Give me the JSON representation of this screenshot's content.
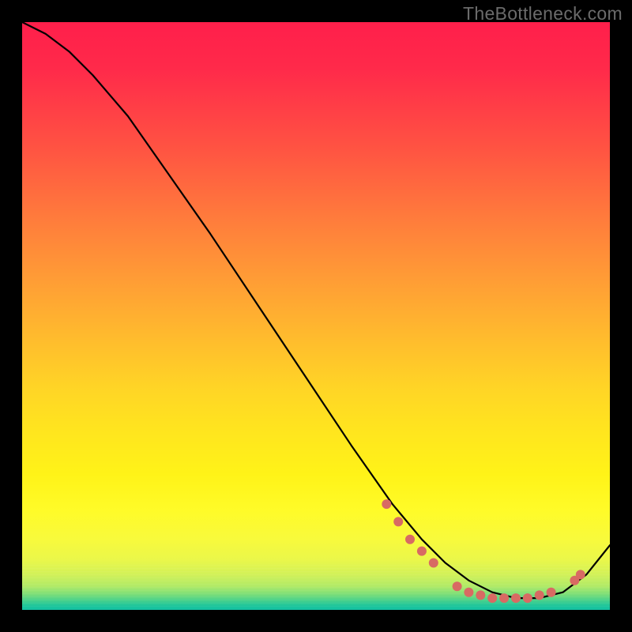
{
  "watermark": "TheBottleneck.com",
  "chart_data": {
    "type": "line",
    "title": "",
    "xlabel": "",
    "ylabel": "",
    "xlim": [
      0,
      100
    ],
    "ylim": [
      0,
      100
    ],
    "series": [
      {
        "name": "curve",
        "x": [
          0,
          4,
          8,
          12,
          18,
          25,
          32,
          40,
          48,
          56,
          63,
          68,
          72,
          76,
          80,
          84,
          88,
          92,
          96,
          100
        ],
        "y": [
          100,
          98,
          95,
          91,
          84,
          74,
          64,
          52,
          40,
          28,
          18,
          12,
          8,
          5,
          3,
          2,
          2,
          3,
          6,
          11
        ]
      }
    ],
    "markers": [
      {
        "x": 62,
        "y": 18
      },
      {
        "x": 64,
        "y": 15
      },
      {
        "x": 66,
        "y": 12
      },
      {
        "x": 68,
        "y": 10
      },
      {
        "x": 70,
        "y": 8
      },
      {
        "x": 74,
        "y": 4
      },
      {
        "x": 76,
        "y": 3
      },
      {
        "x": 78,
        "y": 2.5
      },
      {
        "x": 80,
        "y": 2
      },
      {
        "x": 82,
        "y": 2
      },
      {
        "x": 84,
        "y": 2
      },
      {
        "x": 86,
        "y": 2
      },
      {
        "x": 88,
        "y": 2.5
      },
      {
        "x": 90,
        "y": 3
      },
      {
        "x": 94,
        "y": 5
      },
      {
        "x": 95,
        "y": 6
      }
    ],
    "colors": {
      "line": "#000000",
      "marker": "#d86a63",
      "gradient_top": "#ff1f4b",
      "gradient_mid": "#ffe61e",
      "gradient_bottom": "#10c0a2",
      "background": "#000000",
      "watermark": "#6b6b6b"
    }
  }
}
